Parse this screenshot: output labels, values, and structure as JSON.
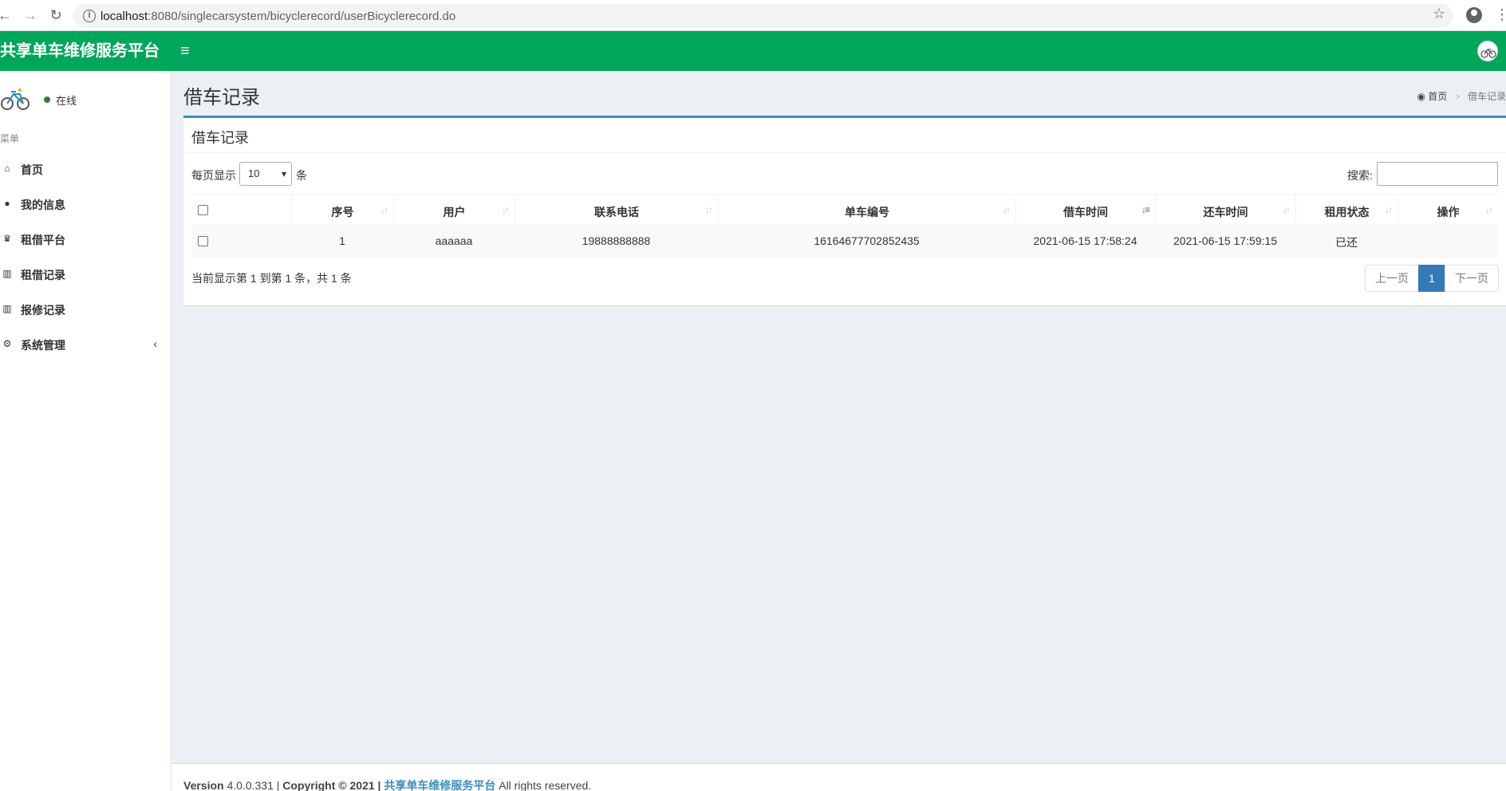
{
  "browser": {
    "url_host": "localhost",
    "url_path": ":8080/singlecarsystem/bicyclerecord/userBicyclerecord.do"
  },
  "header": {
    "logo": "共享单车维修服务平台",
    "menu_icon": "hamburger-icon"
  },
  "sidebar": {
    "status": "在线",
    "menu_header": "菜单",
    "items": [
      {
        "label": "首页",
        "icon": "home-icon"
      },
      {
        "label": "我的信息",
        "icon": "user-icon"
      },
      {
        "label": "租借平台",
        "icon": "trophy-icon"
      },
      {
        "label": "租借记录",
        "icon": "bar-chart-icon"
      },
      {
        "label": "报修记录",
        "icon": "bar-chart-icon"
      },
      {
        "label": "系统管理",
        "icon": "gear-icon"
      }
    ]
  },
  "content": {
    "title": "借车记录",
    "breadcrumb": {
      "home": "首页",
      "current": "借车记录"
    },
    "box_title": "借车记录",
    "length_prefix": "每页显示",
    "length_value": "10",
    "length_suffix": "条",
    "search_label": "搜索:",
    "search_value": "",
    "columns": [
      "序号",
      "用户",
      "联系电话",
      "单车编号",
      "借车时间",
      "还车时间",
      "租用状态",
      "操作"
    ],
    "rows": [
      {
        "index": "1",
        "user": "aaaaaa",
        "phone": "19888888888",
        "bike_no": "16164677702852435",
        "borrow_time": "2021-06-15 17:58:24",
        "return_time": "2021-06-15 17:59:15",
        "status": "已还",
        "action": ""
      }
    ],
    "info": "当前显示第 1 到第 1 条，共 1 条",
    "pager": {
      "prev": "上一页",
      "page": "1",
      "next": "下一页"
    }
  },
  "footer": {
    "version_label": "Version",
    "version": "4.0.0.331",
    "copyright": "Copyright © 2021",
    "site": "共享单车维修服务平台",
    "rights": "All rights reserved."
  },
  "colors": {
    "header": "#00a65a",
    "box_border": "#3c8dbc",
    "pager_active": "#337ab7",
    "online": "#3c763d"
  }
}
